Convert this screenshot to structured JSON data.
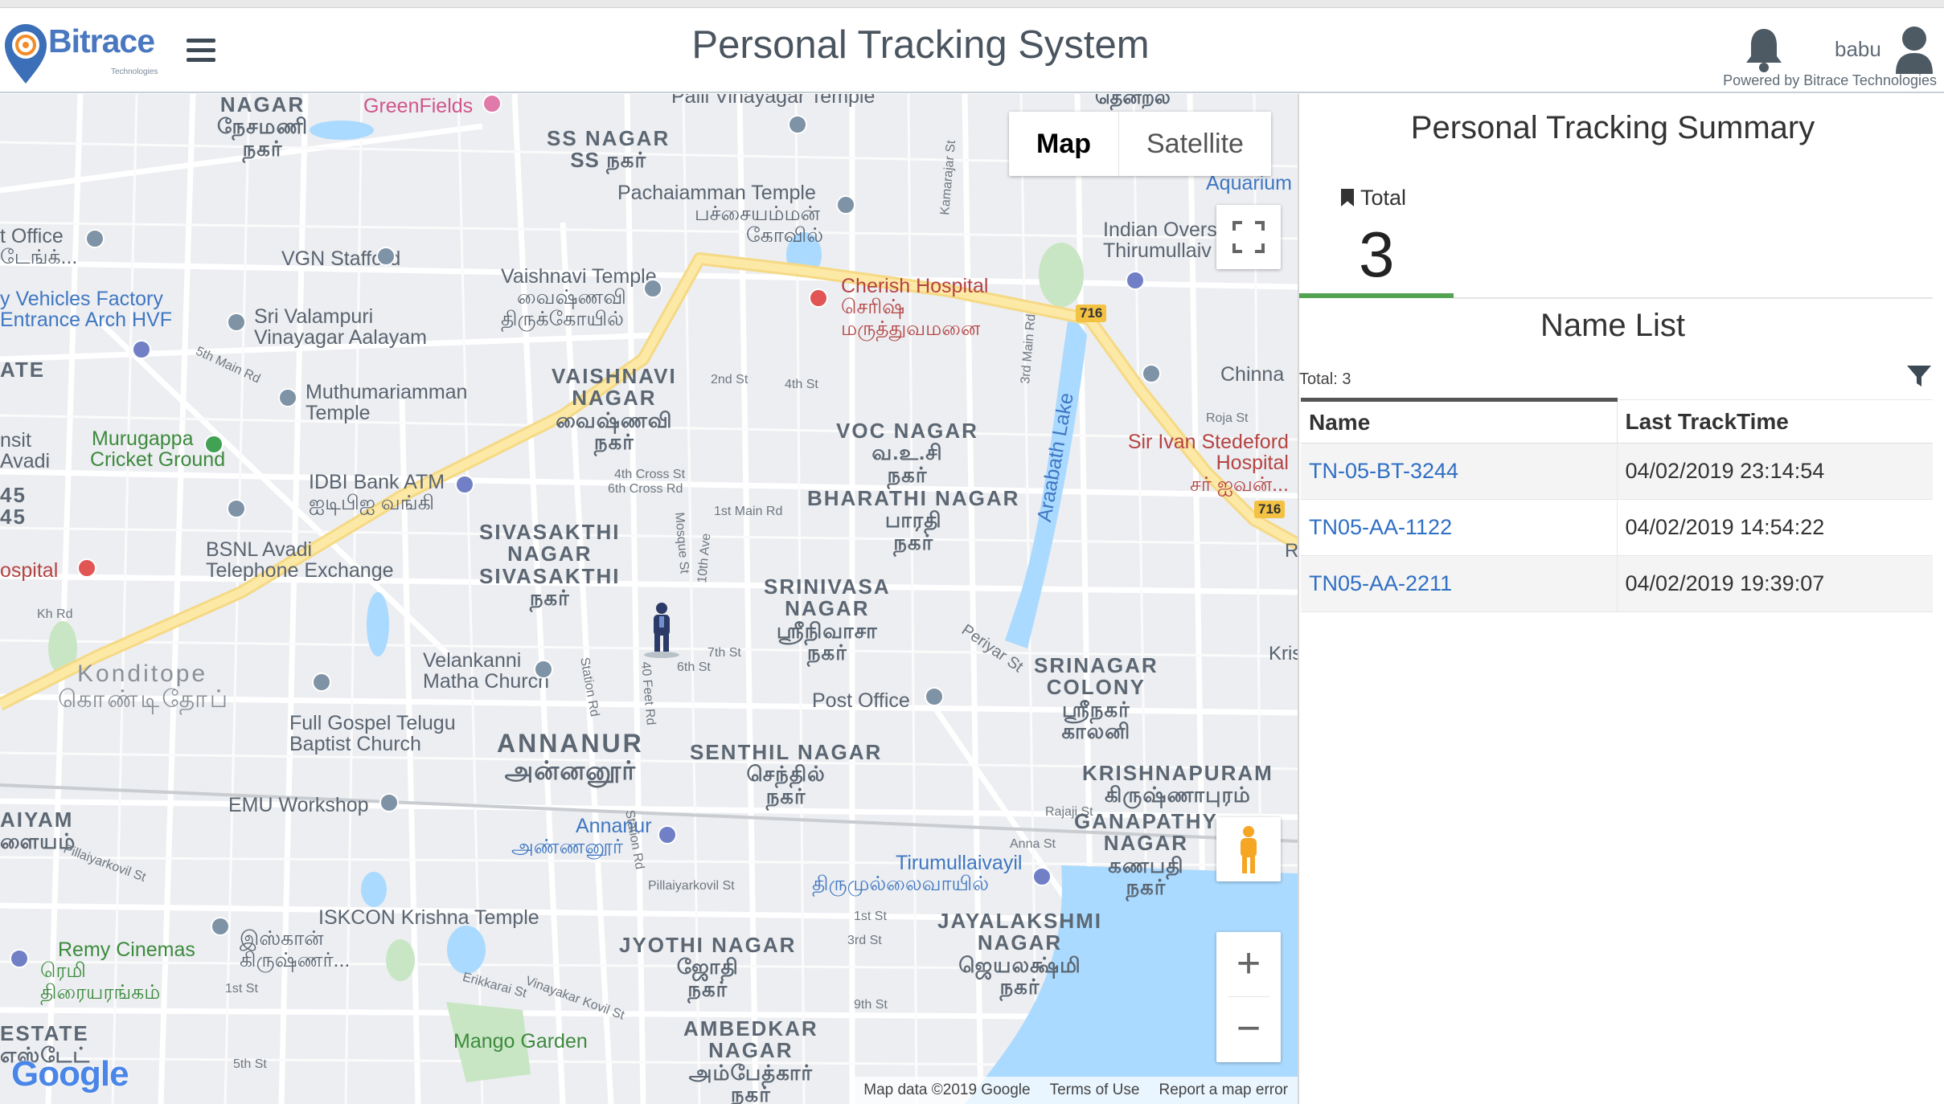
{
  "header": {
    "logo_text": "Bitrace",
    "logo_sub": "Technologies",
    "app_title": "Personal Tracking System",
    "username": "babu",
    "powered_by": "Powered by Bitrace Technologies"
  },
  "map": {
    "type_buttons": [
      "Map",
      "Satellite"
    ],
    "active_type": "Map",
    "attribution": [
      "Map data ©2019 Google",
      "Terms of Use",
      "Report a map error"
    ],
    "google_logo": "Google",
    "labels": {
      "greenfields": "GreenFields",
      "ss_nagar": "SS NAGAR",
      "ss_nagar_ta": "SS நகர்",
      "palli": "Palli Vinayagar Temple",
      "nesamani": "NAGAR",
      "nesamani_ta": "நேசமணி",
      "nesamani_ta2": "நகர்",
      "pachai": "Pachaiamman Temple",
      "pachai_ta": "பச்சையம்மன்",
      "pachai_ta2": "கோவில்",
      "aquarium": "Aquarium",
      "tenral": "தென்றல்",
      "post_office_top": "t Office",
      "post_office_top_ta": "டேங்க்...",
      "vgn": "VGN Stafford",
      "vaishnavi_temple": "Vaishnavi Temple",
      "vaishnavi_temple_ta": "வைஷ்ணவி",
      "vaishnavi_temple_ta2": "திருக்கோயில்",
      "cherish": "Cherish Hospital",
      "cherish_ta": "செரிஷ்",
      "cherish_ta2": "மருத்துவமனை",
      "indian_overseas": "Indian Overs",
      "thirumullaivoyal_top": "Thirumullaiv",
      "vehicles_factory": "y Vehicles Factory",
      "entrance_arch": "Entrance Arch HVF",
      "sri_valampuri": "Sri Valampuri",
      "vinayagar_aalayam": "Vinayagar Aalayam",
      "ate": "ATE",
      "muthumariamman": "Muthumariamman",
      "temple": "Temple",
      "vaishnavi_nagar": "VAISHNAVI",
      "vaishnavi_nagar2": "NAGAR",
      "vaishnavi_nagar_ta": "வைஷ்ணவி",
      "vaishnavi_nagar_ta2": "நகர்",
      "chinna": "Chinna",
      "voc_nagar": "VOC NAGAR",
      "voc_ta": "வ.உ.சி",
      "voc_ta2": "நகர்",
      "sir_ivan": "Sir Ivan Stedeford",
      "hospital": "Hospital",
      "sir_ivan_ta": "சர் ஐவன்...",
      "nsit": "nsit",
      "avadi": "Avadi",
      "murugappa": "Murugappa",
      "cricket_ground": "Cricket Ground",
      "idbi": "IDBI Bank ATM",
      "idbi_ta": "ஐடிபிஐ வங்கி",
      "bharathi_nagar": "BHARATHI NAGAR",
      "bharathi_ta": "பாரதி",
      "bharathi_ta2": "நகர்",
      "araabath": "Araabath Lake",
      "num45a": "45",
      "num45b": "45",
      "sivasakthi": "SIVASAKTHI",
      "sivasakthi2": "NAGAR",
      "sivasakthi3": "SIVASAKTHI",
      "sivasakthi_ta": "நகர்",
      "bsnl": "BSNL Avadi",
      "telephone_exchange": "Telephone Exchange",
      "hospital_left": "ospital",
      "srinivasa": "SRINIVASA",
      "srinivasa2": "NAGAR",
      "srinivasa_ta": "ஸ்ரீநிவாசா",
      "srinivasa_ta2": "நகர்",
      "periyar": "Periyar St",
      "srinagar": "SRINAGAR",
      "colony": "COLONY",
      "srinagar_ta": "ஸ்ரீநகர்",
      "srinagar_ta2": "காலனி",
      "konditope": "Konditope",
      "konditope_ta": "கொண்டிதோப்",
      "velankanni": "Velankanni",
      "matha_church": "Matha Church",
      "post_office": "Post Office",
      "full_gospel": "Full Gospel Telugu",
      "baptist": "Baptist Church",
      "annanur": "ANNANUR",
      "annanur_ta": "அன்னனூர்",
      "senthil": "SENTHIL NAGAR",
      "senthil_ta": "செந்தில்",
      "senthil_ta2": "நகர்",
      "krishnapuram": "KRISHNAPURAM",
      "krishnapuram_ta": "கிருஷ்ணாபுரம்",
      "ganapathy": "GANAPATHY",
      "ganapathy2": "NAGAR",
      "ganapathy_ta": "கணபதி",
      "ganapathy_ta2": "நகர்",
      "emu": "EMU Workshop",
      "first_main": "First Main Rd",
      "aiyam": "AIYAM",
      "aiyam_ta": "ளையம்",
      "annanur_station": "Annanur",
      "annanur_station_ta": "அண்ணனூர்",
      "tirumullaivayil": "Tirumullaivayil",
      "tirumullaivayil_ta": "திருமுல்லைவாயில்",
      "iskcon": "ISKCON Krishna Temple",
      "iskcon_ta": "இஸ்கான்",
      "iskcon_ta2": "கிருஷ்ணர்...",
      "remy": "Remy Cinemas",
      "remy_ta": "ரெமி",
      "remy_ta2": "திரையரங்கம்",
      "jyothi": "JYOTHI NAGAR",
      "jyothi_ta": "ஜோதி",
      "jyothi_ta2": "நகர்",
      "jayalakshmi": "JAYALAKSHMI",
      "jayalakshmi2": "NAGAR",
      "jayalakshmi_ta": "ஜெயலக்ஷ்மி",
      "jayalakshmi_ta2": "நகர்",
      "estate": "ESTATE",
      "estate_ta": "எஸ்டேட்",
      "mango": "Mango Garden",
      "ambedkar": "AMBEDKAR",
      "ambedkar2": "NAGAR",
      "ambedkar_ta": "அம்பேத்கார்",
      "ambedkar_ta2": "நகர்",
      "road_716a": "716",
      "road_716b": "716",
      "road_5th_main": "5th Main Rd",
      "road_2nd_st": "2nd St",
      "road_4th_st": "4th St",
      "road_1st_main": "1st Main Rd",
      "road_7th_st": "7th St",
      "road_6th_st": "6th St",
      "road_kh": "Kh Rd",
      "road_pillaiyar": "Pillaiyarkovil St",
      "road_rajaji": "Rajaji St",
      "road_anna": "Anna St",
      "road_roja": "Roja St",
      "road_9th_st": "9th St",
      "road_1st_st": "1st St",
      "road_3rd_st": "3rd St",
      "road_erikkarai": "Erikkarai St",
      "road_vinayakar": "Vinayakar Kovil St",
      "road_5th_st": "5th St",
      "road_station": "Station Rd",
      "road_40feet": "40 Feet Rd",
      "road_10th_ave": "10th Ave",
      "road_mosque": "Mosque St",
      "road_3rd_main": "3rd Main Rd",
      "road_kamarajar": "Kamarajar St",
      "road_4th_cross": "4th Cross St",
      "road_6th_cross": "6th Cross Rd",
      "kris": "Kris",
      "r": "R"
    }
  },
  "summary": {
    "title": "Personal Tracking Summary",
    "total_label": "Total",
    "total_value": "3",
    "total_color": "#53a353"
  },
  "name_list": {
    "title": "Name List",
    "total_text": "Total: 3",
    "columns": [
      "Name",
      "Last TrackTime"
    ],
    "rows": [
      {
        "name": "TN-05-BT-3244",
        "time": "04/02/2019 23:14:54"
      },
      {
        "name": "TN05-AA-1122",
        "time": "04/02/2019 14:54:22"
      },
      {
        "name": "TN05-AA-2211",
        "time": "04/02/2019 19:39:07"
      }
    ]
  }
}
